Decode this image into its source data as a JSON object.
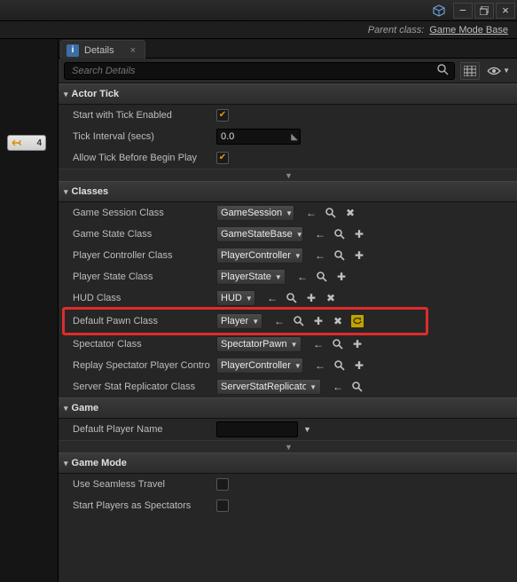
{
  "titlebar": {
    "minimize": "−",
    "maximize": "□",
    "close": "×"
  },
  "parent_class": {
    "label": "Parent class:",
    "value": "Game Mode Base"
  },
  "sidebar": {
    "chip_value": "4"
  },
  "tabs": {
    "details": "Details"
  },
  "search": {
    "placeholder": "Search Details"
  },
  "sections": {
    "actor_tick": {
      "title": "Actor Tick",
      "rows": {
        "start_with_tick": {
          "label": "Start with Tick Enabled",
          "checked": true
        },
        "tick_interval": {
          "label": "Tick Interval (secs)",
          "value": "0.0"
        },
        "allow_before": {
          "label": "Allow Tick Before Begin Play",
          "checked": true
        }
      }
    },
    "classes": {
      "title": "Classes",
      "rows": {
        "game_session": {
          "label": "Game Session Class",
          "value": "GameSession",
          "acts": [
            "back",
            "browse",
            "clear"
          ]
        },
        "game_state": {
          "label": "Game State Class",
          "value": "GameStateBase",
          "acts": [
            "back",
            "browse",
            "add"
          ]
        },
        "player_ctrl": {
          "label": "Player Controller Class",
          "value": "PlayerController",
          "acts": [
            "back",
            "browse",
            "add"
          ]
        },
        "player_state": {
          "label": "Player State Class",
          "value": "PlayerState",
          "acts": [
            "back",
            "browse",
            "add"
          ]
        },
        "hud": {
          "label": "HUD Class",
          "value": "HUD",
          "acts": [
            "back",
            "browse",
            "add",
            "clear"
          ]
        },
        "default_pawn": {
          "label": "Default Pawn Class",
          "value": "Player",
          "acts": [
            "back",
            "browse",
            "add",
            "clear",
            "reset"
          ]
        },
        "spectator": {
          "label": "Spectator Class",
          "value": "SpectatorPawn",
          "acts": [
            "back",
            "browse",
            "add"
          ]
        },
        "replay_spec": {
          "label": "Replay Spectator Player Contro",
          "value": "PlayerController",
          "acts": [
            "back",
            "browse",
            "add"
          ]
        },
        "server_stat": {
          "label": "Server Stat Replicator Class",
          "value": "ServerStatReplicator",
          "acts": [
            "back",
            "browse"
          ]
        }
      }
    },
    "game": {
      "title": "Game",
      "rows": {
        "default_player_name": {
          "label": "Default Player Name",
          "value": ""
        }
      }
    },
    "game_mode": {
      "title": "Game Mode",
      "rows": {
        "seamless": {
          "label": "Use Seamless Travel",
          "checked": false
        },
        "spectators": {
          "label": "Start Players as Spectators",
          "checked": false
        }
      }
    }
  }
}
